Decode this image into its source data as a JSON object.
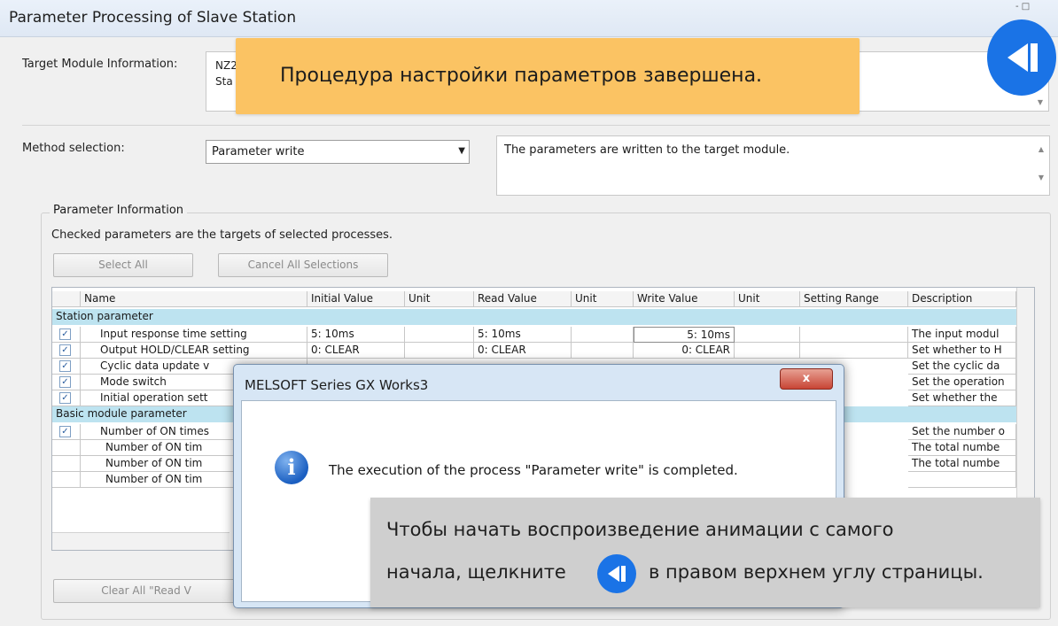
{
  "window": {
    "title": "Parameter Processing of Slave Station",
    "controls": "- □"
  },
  "target": {
    "label": "Target Module Information:",
    "line1": "NZ2",
    "line2": "Sta"
  },
  "method": {
    "label": "Method selection:",
    "selected": "Parameter write",
    "description": "The parameters are written to the target module."
  },
  "param_info": {
    "group_title": "Parameter Information",
    "hint": "Checked parameters are the targets of selected processes.",
    "select_all": "Select All",
    "cancel_all": "Cancel All Selections",
    "clear_read": "Clear All \"Read V"
  },
  "grid": {
    "headers": {
      "name": "Name",
      "initial": "Initial Value",
      "unit1": "Unit",
      "read": "Read Value",
      "unit2": "Unit",
      "write": "Write Value",
      "unit3": "Unit",
      "range": "Setting Range",
      "desc": "Description"
    },
    "section1": "Station parameter",
    "rows1": [
      {
        "name": "Input response time setting",
        "initial": "5: 10ms",
        "read": "5: 10ms",
        "write": "5: 10ms",
        "desc": "The input modul"
      },
      {
        "name": "Output HOLD/CLEAR setting",
        "initial": "0: CLEAR",
        "read": "0: CLEAR",
        "write": "0: CLEAR",
        "desc": "Set whether to H"
      },
      {
        "name": "Cyclic data update v",
        "initial": "",
        "read": "",
        "write": "",
        "desc": "Set the cyclic da"
      },
      {
        "name": "Mode switch",
        "initial": "",
        "read": "",
        "write": "",
        "desc": "Set the operation"
      },
      {
        "name": "Initial operation sett",
        "initial": "",
        "read": "",
        "write": "",
        "desc": "Set whether the"
      }
    ],
    "section2": "Basic module parameter",
    "rows2": [
      {
        "name": "Number of ON times",
        "desc": "Set the number o"
      },
      {
        "name": "Number of ON tim",
        "desc": "The total numbe"
      },
      {
        "name": "Number of ON tim",
        "desc": "The total numbe"
      },
      {
        "name": "Number of ON tim",
        "desc": ""
      }
    ]
  },
  "dialog": {
    "title": "MELSOFT Series GX Works3",
    "message": "The execution of the process \"Parameter write\" is completed.",
    "close": "x"
  },
  "banner": {
    "text": "Процедура настройки параметров завершена."
  },
  "hint_overlay": {
    "line1": "Чтобы начать воспроизведение анимации с самого",
    "line2a": "начала, щелкните",
    "line2b": "в правом верхнем углу страницы."
  },
  "colors": {
    "accent_blue": "#1a73e6",
    "banner": "#fbc363",
    "section": "#bde3f0"
  }
}
